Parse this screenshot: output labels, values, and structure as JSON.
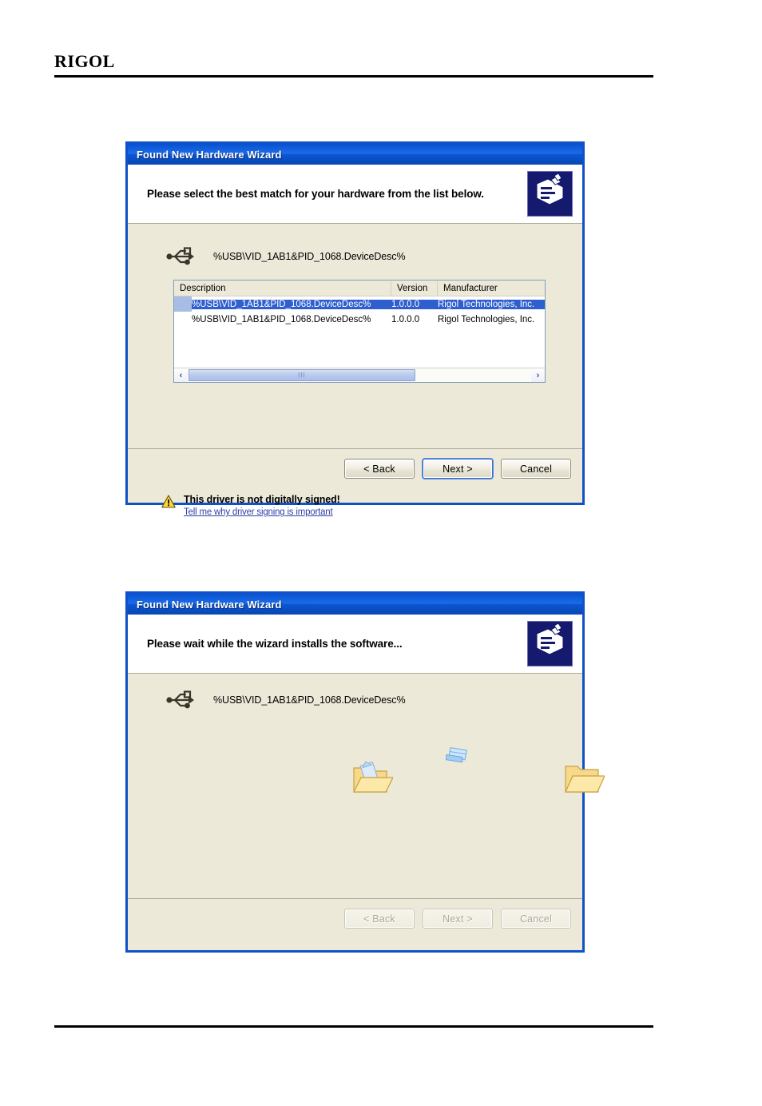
{
  "page": {
    "brand": "RIGOL"
  },
  "dialogs": [
    {
      "id": "select",
      "title": "Found New Hardware Wizard",
      "header_title": "Please select the best match for your hardware from the list below.",
      "wizard_icon": "hardware-wizard-icon",
      "device": {
        "icon": "usb-icon",
        "label": "%USB\\VID_1AB1&PID_1068.DeviceDesc%"
      },
      "list": {
        "columns": [
          "Description",
          "Version",
          "Manufacturer"
        ],
        "rows": [
          {
            "description": "%USB\\VID_1AB1&PID_1068.DeviceDesc%",
            "version": "1.0.0.0",
            "manufacturer": "Rigol Technologies, Inc.",
            "selected": true
          },
          {
            "description": "%USB\\VID_1AB1&PID_1068.DeviceDesc%",
            "version": "1.0.0.0",
            "manufacturer": "Rigol Technologies, Inc.",
            "selected": false
          }
        ],
        "scrollbar": {
          "left_arrow": "‹",
          "right_arrow": "›",
          "grip": "III"
        }
      },
      "warning": {
        "icon": "warning-triangle-icon",
        "title": "This driver is not digitally signed!",
        "link": "Tell me why driver signing is important"
      },
      "buttons": {
        "back": "< Back",
        "next": "Next >",
        "cancel": "Cancel"
      }
    },
    {
      "id": "install",
      "title": "Found New Hardware Wizard",
      "header_title": "Please wait while the wizard installs the software...",
      "wizard_icon": "hardware-wizard-icon",
      "device": {
        "icon": "usb-icon",
        "label": "%USB\\VID_1AB1&PID_1068.DeviceDesc%"
      },
      "animation": {
        "source": "open-folder-with-document-icon",
        "in_transit": "flying-document-icon",
        "destination": "open-folder-icon"
      },
      "buttons": {
        "back": "< Back",
        "next": "Next >",
        "cancel": "Cancel"
      }
    }
  ],
  "colors": {
    "titlebar_blue": "#0a52cf",
    "dialog_border": "#1050c8",
    "body_beige": "#ece9d8",
    "selection_blue": "#2f5fce",
    "link_blue": "#2f3fa8",
    "warning_yellow": "#ffd83c",
    "folder_yellow": "#f2c14a"
  }
}
